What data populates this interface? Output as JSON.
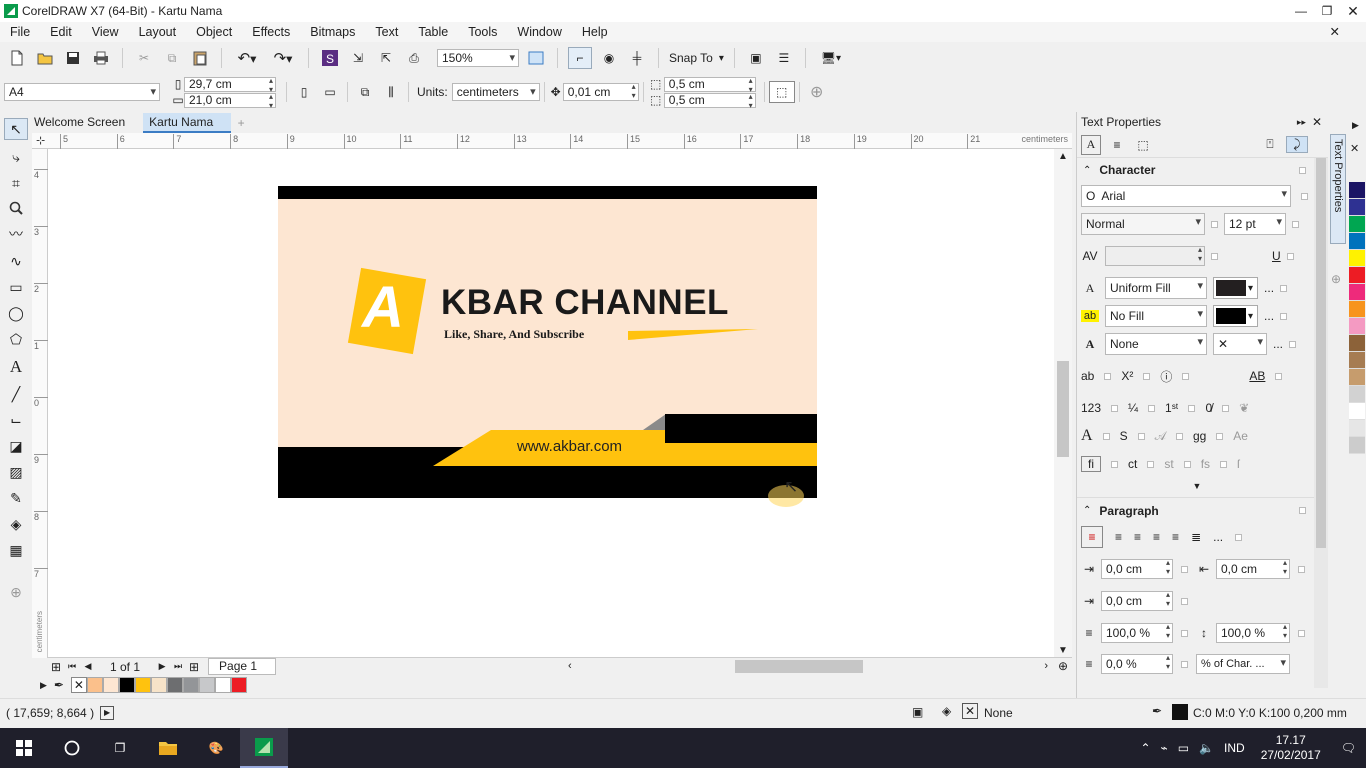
{
  "window": {
    "title": "CorelDRAW X7 (64-Bit) - Kartu Nama"
  },
  "menu": [
    "File",
    "Edit",
    "View",
    "Layout",
    "Object",
    "Effects",
    "Bitmaps",
    "Text",
    "Table",
    "Tools",
    "Window",
    "Help"
  ],
  "toolbar": {
    "zoom": "150%",
    "snap_to": "Snap To"
  },
  "propbar": {
    "page_size": "A4",
    "width": "29,7 cm",
    "height": "21,0 cm",
    "units_label": "Units:",
    "units_value": "centimeters",
    "nudge": "0,01 cm",
    "dup_x": "0,5 cm",
    "dup_y": "0,5 cm"
  },
  "doc_tabs": [
    "Welcome Screen",
    "Kartu Nama"
  ],
  "ruler": {
    "h_ticks": [
      "5",
      "6",
      "7",
      "8",
      "9",
      "10",
      "11",
      "12",
      "13",
      "14",
      "15",
      "16",
      "17",
      "18",
      "19",
      "20",
      "21"
    ],
    "unit": "centimeters",
    "v_ticks": [
      "4",
      "3",
      "2",
      "1",
      "0",
      "9",
      "8",
      "7"
    ],
    "v_unit": "centimeters"
  },
  "card": {
    "logo_letter": "A",
    "brand": "KBAR CHANNEL",
    "tagline": "Like, Share, And Subscribe",
    "website": "www.akbar.com",
    "colors": {
      "cream": "#fde6d2",
      "black": "#000000",
      "yellow": "#ffc20e"
    }
  },
  "page_nav": {
    "counter": "1 of 1",
    "tab": "Page 1"
  },
  "palette": [
    "#fbc08b",
    "#fde6d2",
    "#000000",
    "#ffc20e",
    "#f7e3c8",
    "#6d6e70",
    "#939598",
    "#c7c8ca",
    "#ffffff",
    "#ed1c24"
  ],
  "right_palette": [
    "#1b1464",
    "#2e3192",
    "#00a651",
    "#0072bc",
    "#fff200",
    "#ed1c24",
    "#ee2a7b",
    "#f7941d",
    "#f49ac2",
    "#8c6239",
    "#a67c52",
    "#c69c6d",
    "#d2d2d2",
    "#ffffff",
    "#e6e6e6",
    "#cccccc"
  ],
  "status": {
    "coords": "( 17,659; 8,664 )",
    "fill_none": "None",
    "outline": "C:0 M:0 Y:0 K:100  0,200 mm"
  },
  "docker": {
    "title": "Text Properties",
    "side_tab": "Text Properties",
    "character_label": "Character",
    "font": "Arial",
    "style": "Normal",
    "size": "12 pt",
    "fill_type": "Uniform Fill",
    "bg_fill": "No Fill",
    "outline": "None",
    "more": "...",
    "paragraph_label": "Paragraph",
    "indent_first": "0,0 cm",
    "indent_right": "0,0 cm",
    "indent_left": "0,0 cm",
    "line_spacing": "100,0 %",
    "char_spacing": "100,0 %",
    "before_para": "0,0 %",
    "spacing_unit": "% of Char. ..."
  },
  "taskbar": {
    "lang": "IND",
    "time": "17.17",
    "date": "27/02/2017"
  }
}
